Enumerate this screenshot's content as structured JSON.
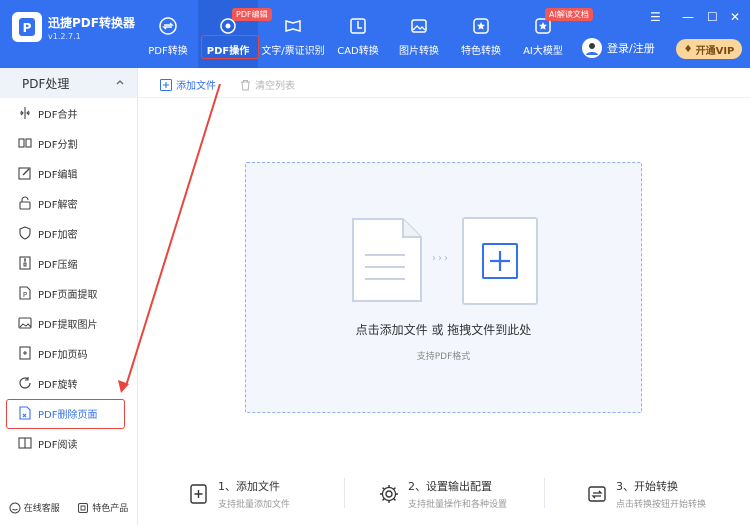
{
  "app": {
    "name": "迅捷PDF转换器",
    "version": "v1.2.7.1"
  },
  "nav": [
    {
      "label": "PDF转换",
      "icon": "convert-icon"
    },
    {
      "label": "PDF操作",
      "icon": "pdf-operate-icon",
      "badge": "PDF编辑",
      "active": true
    },
    {
      "label": "文字/票证识别",
      "icon": "ocr-icon"
    },
    {
      "label": "CAD转换",
      "icon": "cad-icon"
    },
    {
      "label": "图片转换",
      "icon": "image-icon"
    },
    {
      "label": "特色转换",
      "icon": "feature-icon"
    },
    {
      "label": "AI大模型",
      "icon": "ai-icon",
      "badge": "AI解读文档"
    }
  ],
  "login_label": "登录/注册",
  "vip_label": "开通VIP",
  "sidebar": {
    "header": "PDF处理",
    "items": [
      {
        "label": "PDF合并",
        "icon": "merge-icon"
      },
      {
        "label": "PDF分割",
        "icon": "split-icon"
      },
      {
        "label": "PDF编辑",
        "icon": "edit-icon"
      },
      {
        "label": "PDF解密",
        "icon": "unlock-icon"
      },
      {
        "label": "PDF加密",
        "icon": "shield-icon"
      },
      {
        "label": "PDF压缩",
        "icon": "compress-icon"
      },
      {
        "label": "PDF页面提取",
        "icon": "extract-page-icon"
      },
      {
        "label": "PDF提取图片",
        "icon": "extract-image-icon"
      },
      {
        "label": "PDF加页码",
        "icon": "page-number-icon"
      },
      {
        "label": "PDF旋转",
        "icon": "rotate-icon"
      },
      {
        "label": "PDF删除页面",
        "icon": "delete-page-icon",
        "selected": true
      },
      {
        "label": "PDF阅读",
        "icon": "read-icon"
      }
    ],
    "footer": {
      "service": "在线客服",
      "products": "特色产品"
    }
  },
  "toolbar": {
    "add_file": "添加文件",
    "clear_list": "清空列表"
  },
  "dropzone": {
    "main": "点击添加文件 或 拖拽文件到此处",
    "sub": "支持PDF格式"
  },
  "steps": [
    {
      "title": "1、添加文件",
      "sub": "支持批量添加文件"
    },
    {
      "title": "2、设置输出配置",
      "sub": "支持批量操作和各种设置"
    },
    {
      "title": "3、开始转换",
      "sub": "点击转换按钮开始转换"
    }
  ],
  "colors": {
    "brand": "#3471f0",
    "badge": "#f25757",
    "annotation": "#e8453c",
    "vip": "#fbd69a"
  }
}
